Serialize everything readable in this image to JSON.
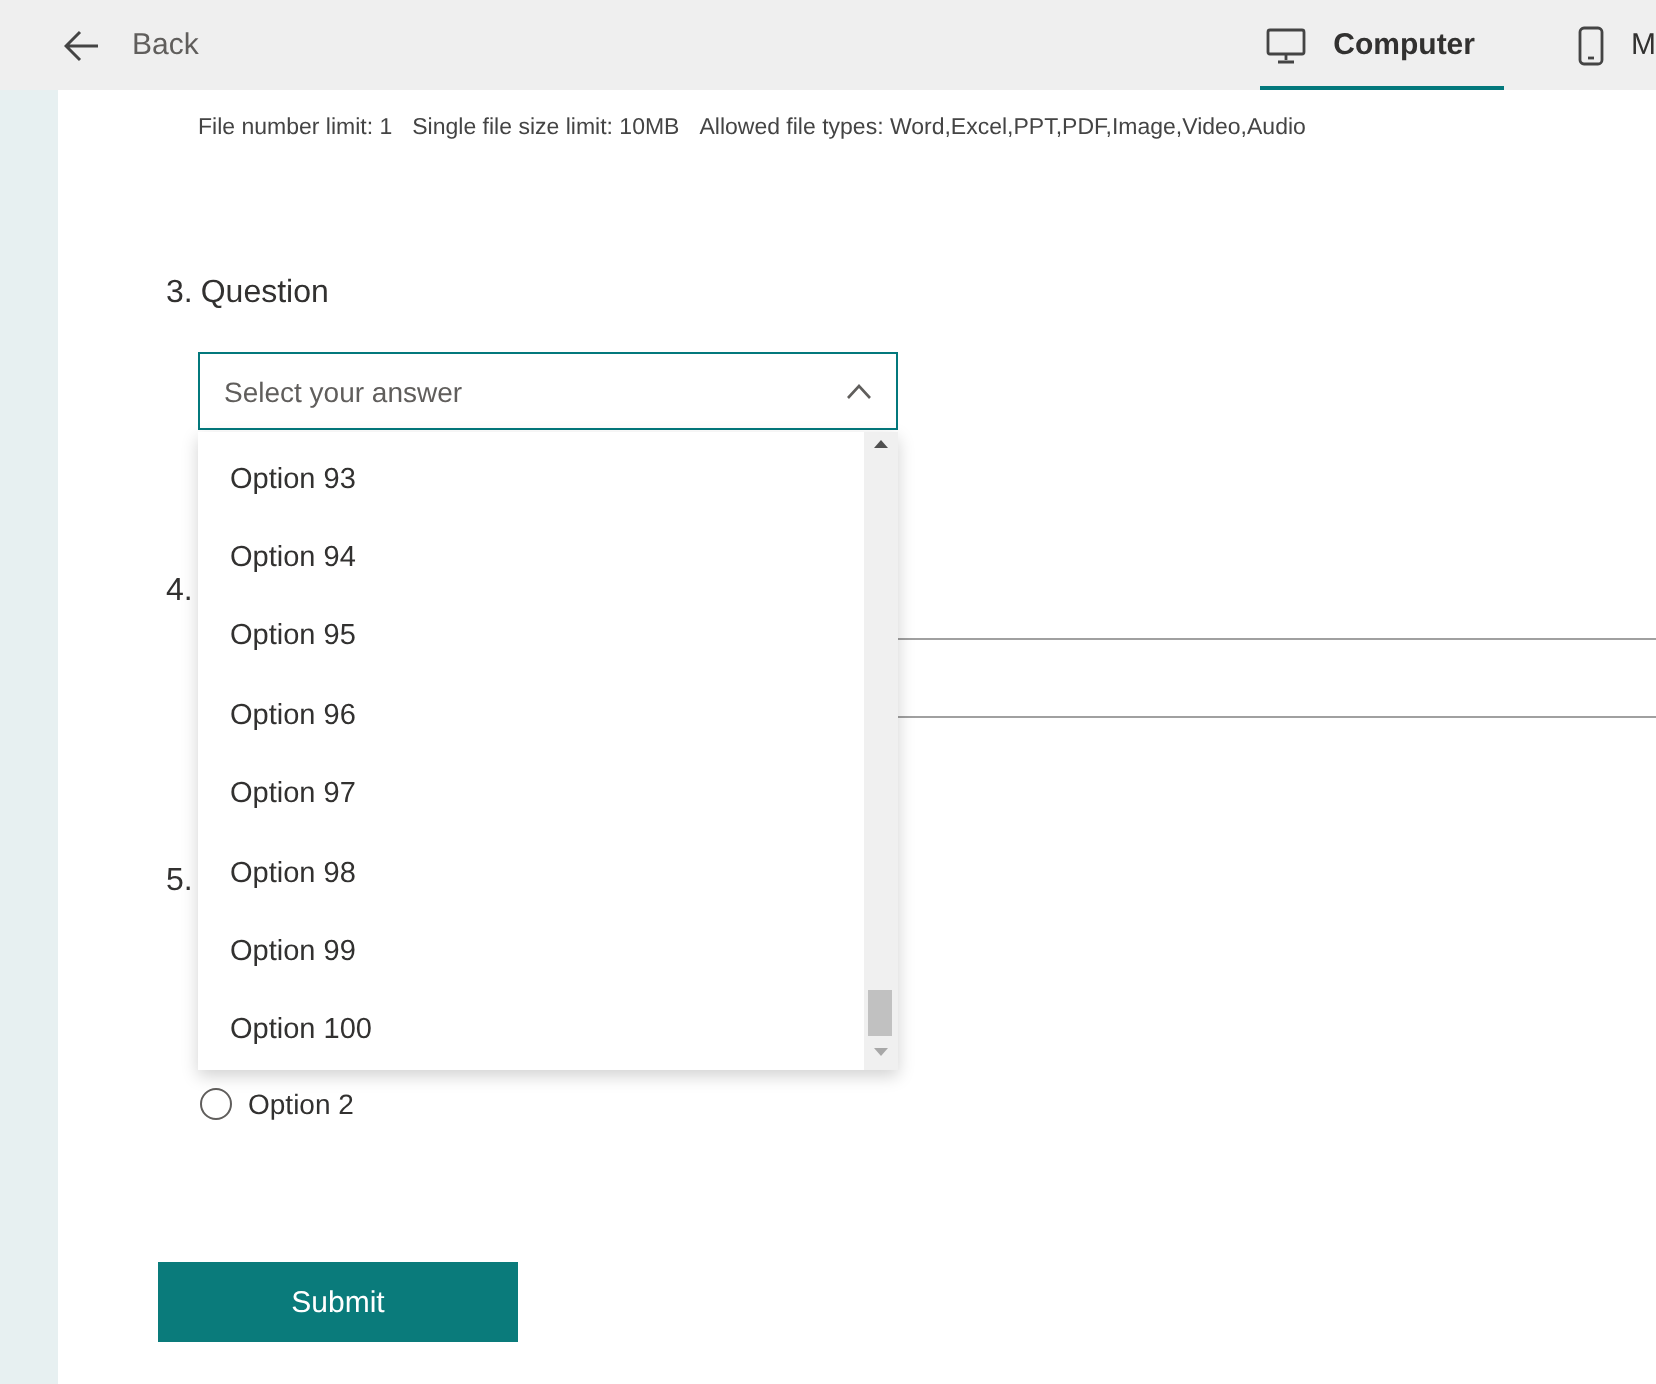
{
  "header": {
    "back_label": "Back",
    "tabs": [
      {
        "kind": "computer",
        "label": "Computer",
        "selected": true
      },
      {
        "kind": "phone",
        "label": "M",
        "selected": false
      }
    ]
  },
  "upload_info": [
    "File number limit: 1",
    "Single file size limit: 10MB",
    "Allowed file types: Word,Excel,PPT,PDF,Image,Video,Audio"
  ],
  "questions": [
    {
      "kind": "dropdown",
      "number": "3.",
      "title": "Question",
      "placeholder": "Select your answer",
      "expanded": true,
      "options": [
        "Option 93",
        "Option 94",
        "Option 95",
        "Option 96",
        "Option 97",
        "Option 98",
        "Option 99",
        "Option 100"
      ]
    },
    {
      "kind": "text",
      "number": "4."
    },
    {
      "kind": "choice",
      "number": "5.",
      "options": [
        {
          "label": "Option 2",
          "selected": false
        }
      ]
    }
  ],
  "submit_label": "Submit"
}
